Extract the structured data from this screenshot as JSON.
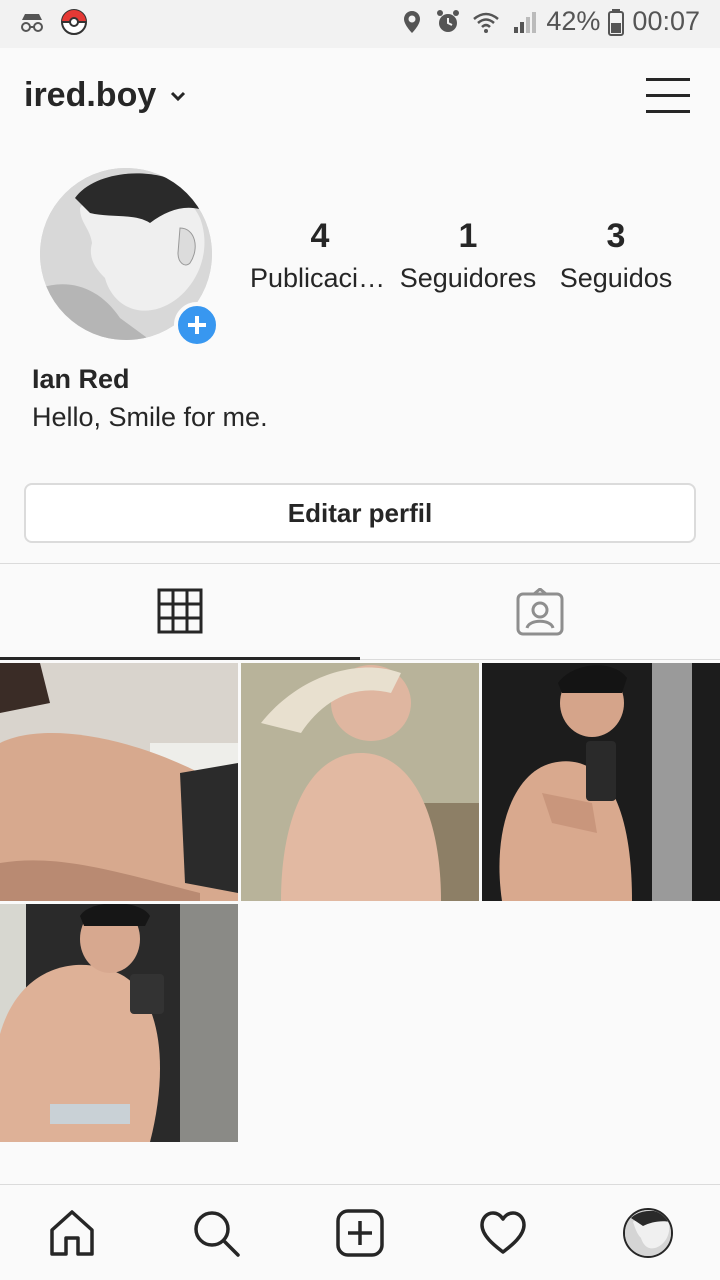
{
  "status_bar": {
    "battery": "42%",
    "time": "00:07",
    "left_icons": [
      "incognito-icon",
      "pokeball-icon"
    ],
    "right_icons": [
      "location-icon",
      "alarm-icon",
      "wifi-icon",
      "signal-icon",
      "battery-icon"
    ]
  },
  "header": {
    "username": "ired.boy",
    "icons": [
      "chevron-down-icon",
      "hamburger-menu-icon"
    ]
  },
  "profile": {
    "stats": [
      {
        "value": "4",
        "label": "Publicaciones"
      },
      {
        "value": "1",
        "label": "Seguidores"
      },
      {
        "value": "3",
        "label": "Seguidos"
      }
    ],
    "full_name": "Ian Red",
    "bio": "Hello, Smile for me.",
    "edit_button": "Editar perfil"
  },
  "tabs": [
    {
      "icon": "grid-icon",
      "active": true
    },
    {
      "icon": "tagged-icon",
      "active": false
    }
  ],
  "posts": [
    {
      "label": "photo-1"
    },
    {
      "label": "photo-2"
    },
    {
      "label": "photo-3"
    },
    {
      "label": "photo-4"
    }
  ],
  "bottom_nav": [
    "home-icon",
    "search-icon",
    "add-post-icon",
    "heart-icon",
    "profile-avatar"
  ],
  "colors": {
    "accent": "#3897f0",
    "text": "#262626",
    "border": "#dbdbdb",
    "background": "#fafafa"
  }
}
